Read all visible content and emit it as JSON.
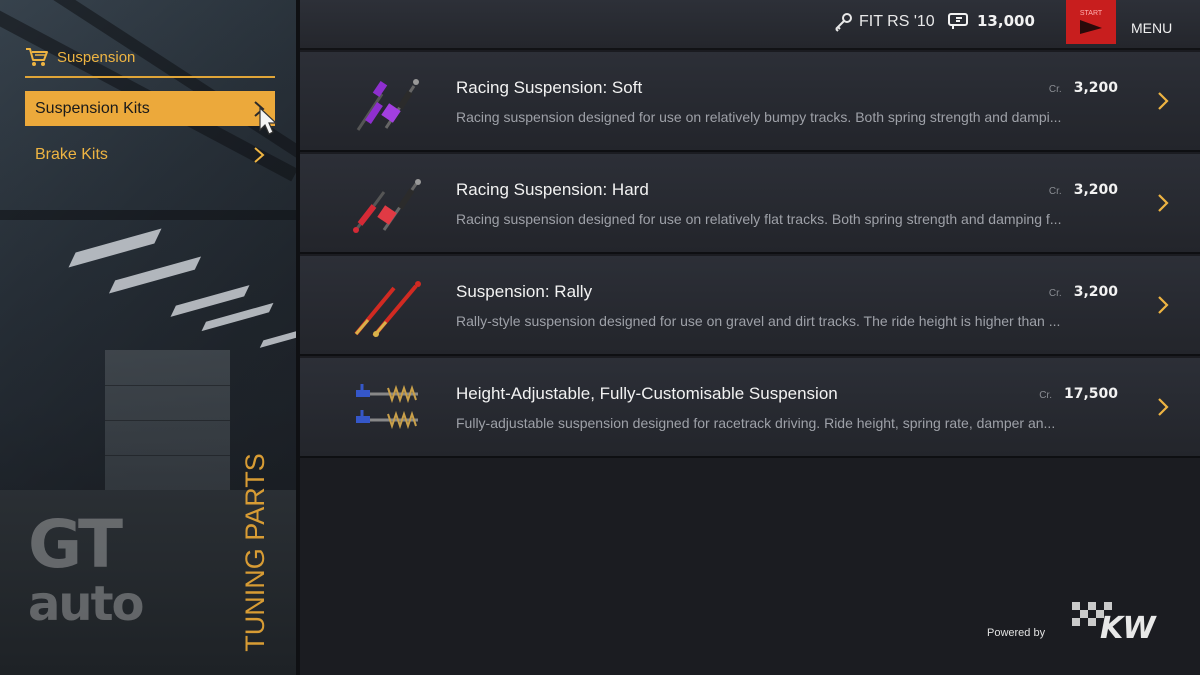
{
  "sidebar": {
    "category": "Suspension",
    "items": [
      {
        "label": "Suspension Kits",
        "active": true
      },
      {
        "label": "Brake Kits",
        "active": false
      }
    ],
    "section_title": "TUNING PARTS",
    "logo": {
      "line1": "GT",
      "line2": "auto"
    }
  },
  "topbar": {
    "car": "FIT RS '10",
    "credits": "13,000",
    "start_label": "START",
    "menu_label": "MENU"
  },
  "parts": [
    {
      "name": "Racing Suspension: Soft",
      "currency": "Cr.",
      "price": "3,200",
      "description": "Racing suspension designed for use on relatively bumpy tracks. Both spring strength and dampi...",
      "color": "#8e2fcf",
      "icon": "purple-coilover-icon"
    },
    {
      "name": "Racing Suspension: Hard",
      "currency": "Cr.",
      "price": "3,200",
      "description": "Racing suspension designed for use on relatively flat tracks. Both spring strength and damping f...",
      "color": "#d42a36",
      "icon": "red-coilover-icon"
    },
    {
      "name": "Suspension: Rally",
      "currency": "Cr.",
      "price": "3,200",
      "description": "Rally-style suspension designed for use on gravel and dirt tracks. The ride height is higher than ...",
      "color": "#d12a22",
      "icon": "rally-shock-icon"
    },
    {
      "name": "Height-Adjustable, Fully-Customisable Suspension",
      "currency": "Cr.",
      "price": "17,500",
      "description": "Fully-adjustable suspension designed for racetrack driving. Ride height, spring rate, damper an...",
      "color": "#3557c9",
      "icon": "blue-coilover-icon"
    }
  ],
  "footer": {
    "powered_by": "Powered by",
    "brand": "KW"
  },
  "colors": {
    "accent": "#eca93b",
    "start": "#c81e1e",
    "bg": "#1b1c21"
  }
}
